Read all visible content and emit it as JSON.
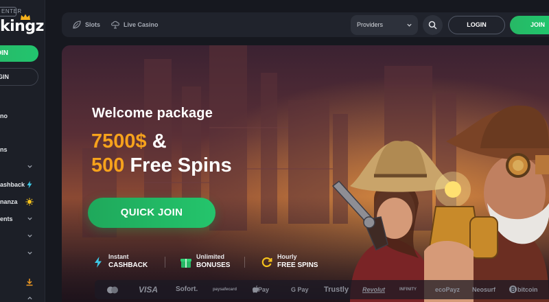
{
  "logo": {
    "tagline": "ENTER",
    "name": "kingz"
  },
  "sidebar": {
    "join_label": "JOIN",
    "login_label": "LOGIN",
    "items": [
      {
        "label": "no"
      },
      {
        "label": "ns"
      },
      {
        "label": ""
      },
      {
        "label": "ashback"
      },
      {
        "label": "nanza"
      },
      {
        "label": "ents"
      },
      {
        "label": ""
      },
      {
        "label": ""
      }
    ]
  },
  "header": {
    "nav": [
      {
        "label": "Slots"
      },
      {
        "label": "Live Casino"
      }
    ],
    "providers_label": "Providers",
    "login_label": "LOGIN",
    "join_label": "JOIN"
  },
  "hero": {
    "title": "Welcome package",
    "line1_gold": "7500$",
    "line1_white": "&",
    "line2_gold": "500",
    "line2_white": "Free Spins",
    "cta_label": "QUICK JOIN",
    "perks": [
      {
        "line1": "Instant",
        "line2": "CASHBACK"
      },
      {
        "line1": "Unlimited",
        "line2": "BONUSES"
      },
      {
        "line1": "Hourly",
        "line2": "FREE SPINS"
      }
    ]
  },
  "payments": [
    {
      "label": ""
    },
    {
      "label": "VISA"
    },
    {
      "label": "Sofort."
    },
    {
      "label": "paysafecard"
    },
    {
      "label": " Pay"
    },
    {
      "label": "G Pay"
    },
    {
      "label": "Trustly"
    },
    {
      "label": "Revolut"
    },
    {
      "label": "INFINITY"
    },
    {
      "label": "ecoPayz"
    },
    {
      "label": "Neosurf"
    },
    {
      "label": "bitcoin"
    }
  ],
  "colors": {
    "accent_green": "#24c56c",
    "gold": "#f6a21c",
    "bg": "#16181f"
  }
}
